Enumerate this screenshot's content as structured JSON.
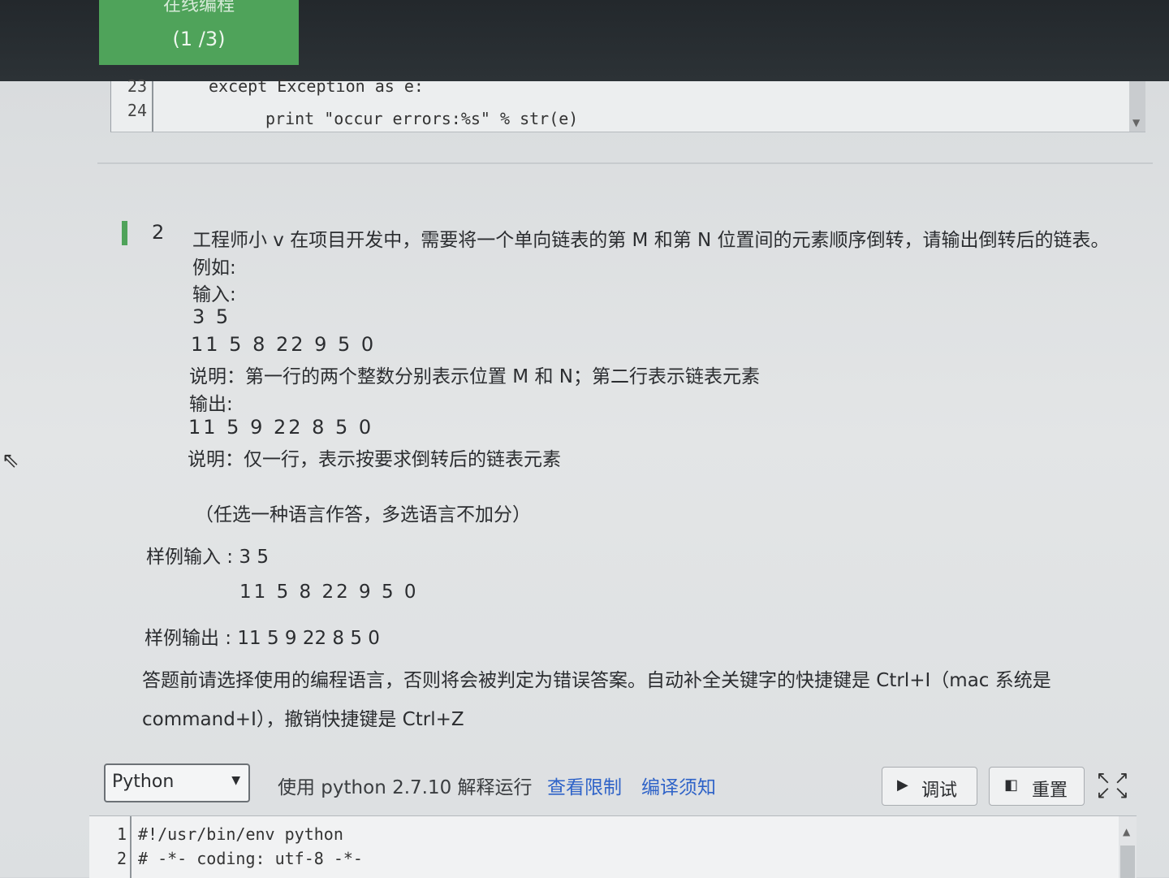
{
  "header": {
    "title": "在线编程",
    "progress": "(1 /3)"
  },
  "prev_code": {
    "lines": [
      {
        "num": "23",
        "text": "except Exception as e:"
      },
      {
        "num": "24",
        "text": "print \"occur errors:%s\" % str(e)"
      }
    ]
  },
  "question": {
    "number": "2",
    "title": "工程师小 v 在项目开发中，需要将一个单向链表的第 M 和第 N 位置间的元素顺序倒转，请输出倒转后的链表。",
    "example_label": "例如:",
    "input_label": "输入:",
    "input_line1": "3 5",
    "input_line2": "11 5 8 22 9 5 0",
    "input_desc": "说明：第一行的两个整数分别表示位置 M 和 N；第二行表示链表元素",
    "output_label": "输出:",
    "output_line": "11 5 9 22 8 5 0",
    "output_desc": "说明：仅一行，表示按要求倒转后的链表元素",
    "note": "（任选一种语言作答，多选语言不加分）",
    "sample_input_label": "样例输入 : 3 5",
    "sample_input_line2": "11 5 8 22 9 5 0",
    "sample_output_label": "样例输出 : 11 5 9 22 8 5 0",
    "instructions_line1": "答题前请选择使用的编程语言，否则将会被判定为错误答案。自动补全关键字的快捷键是 Ctrl+I（mac 系统是",
    "instructions_line2": "command+I），撤销快捷键是 Ctrl+Z"
  },
  "toolbar": {
    "language": "Python",
    "runtime": "使用 python 2.7.10 解释运行",
    "view_limits": "查看限制",
    "compile_notes": "编译须知",
    "debug_label": "调试",
    "reset_label": "重置"
  },
  "editor": {
    "lines": [
      {
        "num": "1",
        "text": "#!/usr/bin/env python"
      },
      {
        "num": "2",
        "text": "# -*- coding: utf-8 -*-"
      }
    ]
  }
}
